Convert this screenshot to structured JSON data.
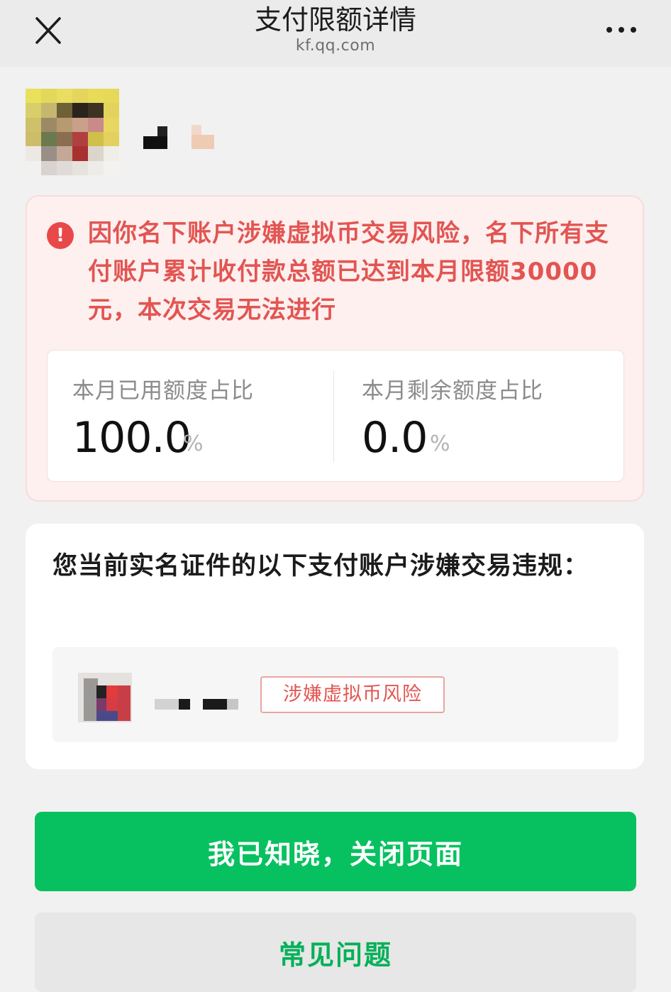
{
  "nav": {
    "title": "支付限额详情",
    "domain": "kf.qq.com"
  },
  "warning": {
    "message": "因你名下账户涉嫌虚拟币交易风险，名下所有支付账户累计收付款总额已达到本月限额30000元，本次交易无法进行"
  },
  "quota": {
    "used_label": "本月已用额度占比",
    "used_value": "100.0",
    "remaining_label": "本月剩余额度占比",
    "remaining_value": "0.0",
    "unit": "%"
  },
  "violation": {
    "title": "您当前实名证件的以下支付账户涉嫌交易违规：",
    "risk_tag": "涉嫌虚拟币风险"
  },
  "buttons": {
    "primary": "我已知晓，关闭页面",
    "secondary": "常见问题"
  },
  "colors": {
    "accent_green": "#07c160",
    "warning_red": "#e25552"
  }
}
